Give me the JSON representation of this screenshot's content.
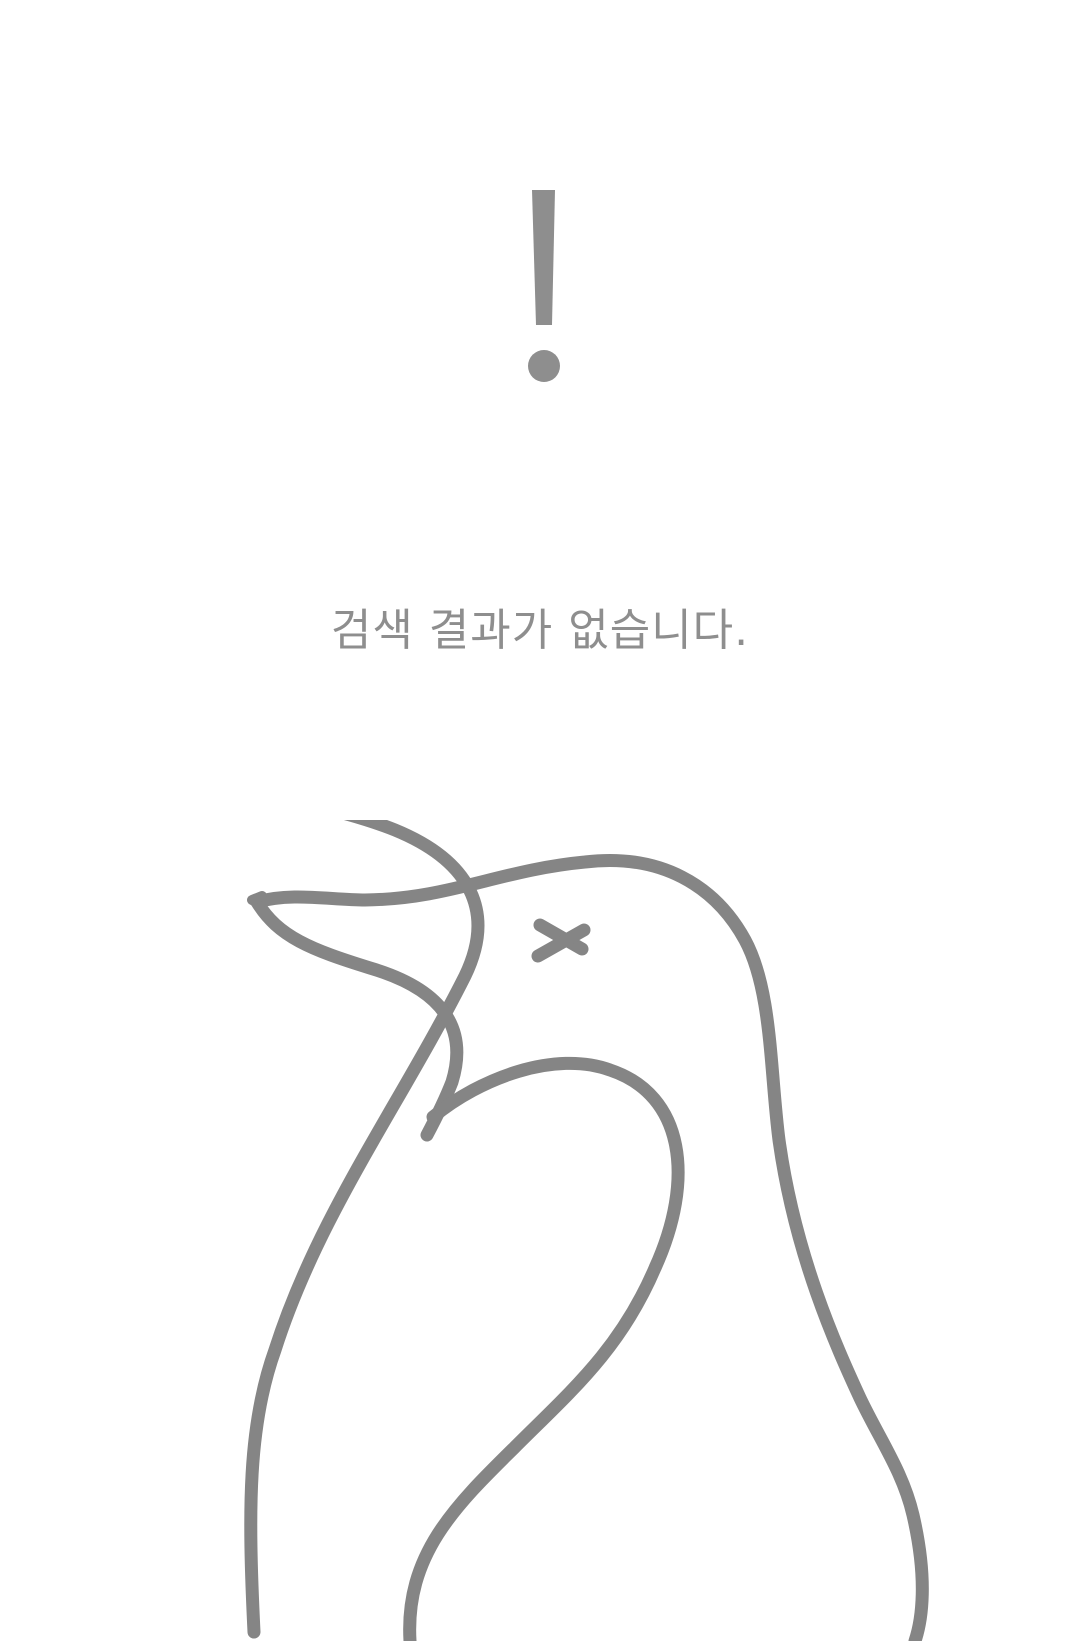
{
  "empty_state": {
    "message": "검색 결과가 없습니다.",
    "icon": "exclamation-icon",
    "illustration": "penguin-illustration",
    "color": "#8e8e8e",
    "outline_color": "#858585"
  }
}
